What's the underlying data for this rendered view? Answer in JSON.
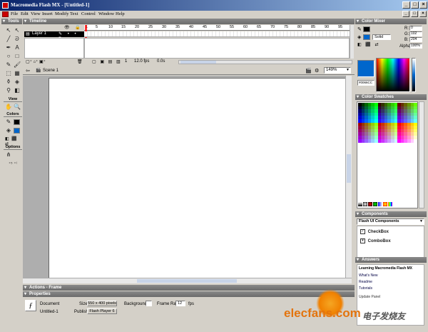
{
  "window": {
    "title": "Macromedia Flash MX - [Untitled-1]"
  },
  "menu": [
    "File",
    "Edit",
    "View",
    "Insert",
    "Modify",
    "Text",
    "Control",
    "Window",
    "Help"
  ],
  "tools": {
    "header": "Tools",
    "sections": {
      "view": "View",
      "colors": "Colors",
      "options": "Options"
    }
  },
  "timeline": {
    "header": "Timeline",
    "layer_name": "Layer 1",
    "frame_numbers": [
      "1",
      "5",
      "10",
      "15",
      "20",
      "25",
      "30",
      "35",
      "40",
      "45",
      "50",
      "55",
      "60",
      "65",
      "70",
      "75",
      "80",
      "85",
      "90",
      "95"
    ],
    "current_frame": "1",
    "frame_rate": "12.0 fps",
    "elapsed": "0.0s"
  },
  "stage": {
    "scene": "Scene 1",
    "zoom": "149%"
  },
  "color_mixer": {
    "header": "Color Mixer",
    "r": "0",
    "g": "102",
    "b": "204",
    "fill_type": "Solid",
    "alpha": "100%",
    "hex": "#0066CC",
    "color": "#0066cc"
  },
  "color_swatches": {
    "header": "Color Swatches"
  },
  "components": {
    "header": "Components",
    "set": "Flash UI Components",
    "items": [
      "CheckBox",
      "ComboBox"
    ]
  },
  "answers": {
    "header": "Answers",
    "title": "Learning Macromedia Flash MX",
    "links": [
      "What's New",
      "Readme",
      "Tutorials"
    ],
    "extra": "Update Panel"
  },
  "actions": {
    "header": "Actions - Frame"
  },
  "properties": {
    "header": "Properties",
    "doc_type": "Document",
    "doc_name": "Untitled-1",
    "size_label": "Size:",
    "size_value": "550 x 400 pixels",
    "publish_label": "Publish:",
    "publish_value": "Flash Player 6",
    "background_label": "Background:",
    "frame_rate_label": "Frame Rate:",
    "frame_rate_value": "12",
    "fps_label": "fps"
  },
  "watermark": {
    "text": "elecfans.com",
    "cn": "电子发烧友"
  }
}
